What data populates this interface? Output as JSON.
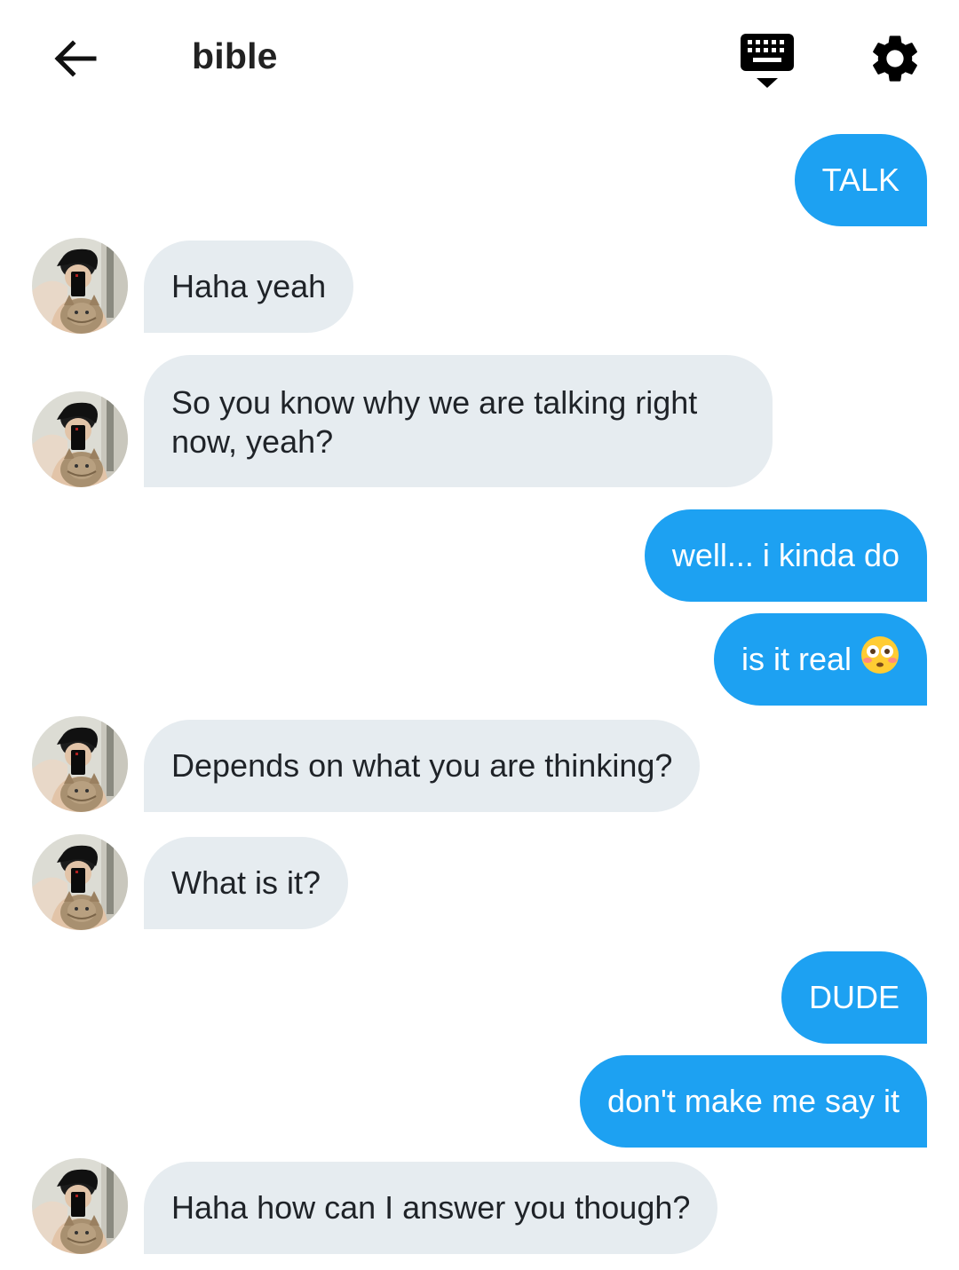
{
  "header": {
    "title": "bible",
    "back_icon": "arrow-left-icon",
    "keyboard_icon": "keyboard-icon",
    "settings_icon": "gear-icon"
  },
  "colors": {
    "outgoing_bubble": "#1da1f2",
    "incoming_bubble": "#e6ecf0"
  },
  "messages": [
    {
      "from": "me",
      "text": "TALK"
    },
    {
      "from": "them",
      "text": "Haha yeah"
    },
    {
      "from": "them",
      "text": "So you know why we are talking right now, yeah?"
    },
    {
      "from": "me",
      "text": "well... i kinda do"
    },
    {
      "from": "me",
      "text": "is it real",
      "emoji": "flushed-face-emoji"
    },
    {
      "from": "them",
      "text": "Depends on what you are thinking?"
    },
    {
      "from": "them",
      "text": "What is it?"
    },
    {
      "from": "me",
      "text": "DUDE"
    },
    {
      "from": "me",
      "text": "don't make me say it"
    },
    {
      "from": "them",
      "text": "Haha how can I answer you though?"
    }
  ]
}
